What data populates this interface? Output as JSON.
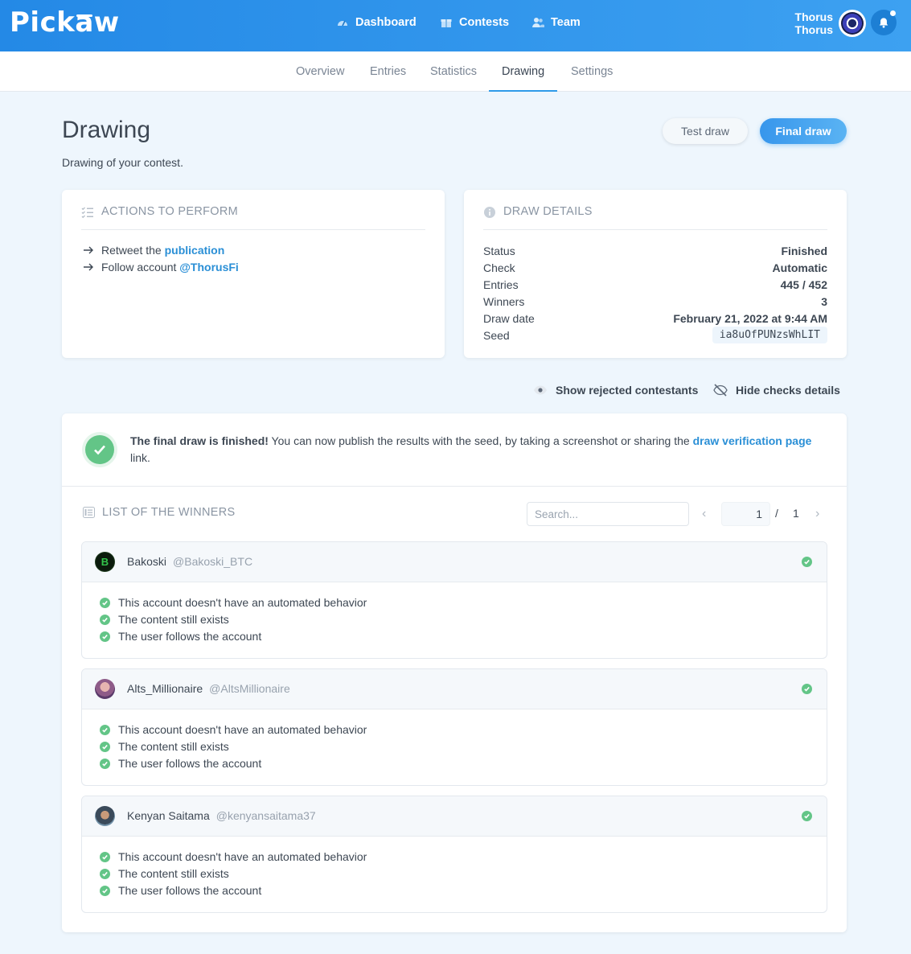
{
  "brand": {
    "logo_pre": "Pick",
    "logo_a": "a",
    "logo_post": "w"
  },
  "nav": {
    "dashboard": "Dashboard",
    "contests": "Contests",
    "team": "Team"
  },
  "user": {
    "line1": "Thorus",
    "line2": "Thorus"
  },
  "tabs": [
    "Overview",
    "Entries",
    "Statistics",
    "Drawing",
    "Settings"
  ],
  "active_tab": "Drawing",
  "page": {
    "title": "Drawing",
    "subtitle": "Drawing of your contest."
  },
  "buttons": {
    "test_draw": "Test draw",
    "final_draw": "Final draw"
  },
  "actions": {
    "heading": "ACTIONS TO PERFORM",
    "items": [
      {
        "text": "Retweet the ",
        "link": "publication"
      },
      {
        "text": "Follow account ",
        "link": "@ThorusFi"
      }
    ]
  },
  "details": {
    "heading": "DRAW DETAILS",
    "rows": [
      {
        "label": "Status",
        "value": "Finished"
      },
      {
        "label": "Check",
        "value": "Automatic"
      },
      {
        "label": "Entries",
        "value": "445 / 452"
      },
      {
        "label": "Winners",
        "value": "3"
      },
      {
        "label": "Draw date",
        "value": "February 21, 2022 at 9:44 AM"
      },
      {
        "label": "Seed",
        "value": "ia8uOfPUNzsWhLIT"
      }
    ]
  },
  "toggles": {
    "show_rejected": "Show rejected contestants",
    "hide_checks": "Hide checks details"
  },
  "result": {
    "bold": "The final draw is finished!",
    "text": " You can now publish the results with the seed, by taking a screenshot or sharing the ",
    "link": "draw verification page",
    "tail": " link."
  },
  "winners": {
    "heading": "LIST OF THE WINNERS",
    "search_placeholder": "Search...",
    "page_current": "1",
    "page_sep": "/",
    "page_total": "1",
    "items": [
      {
        "name": "Bakoski",
        "handle": "@Bakoski_BTC",
        "checks": [
          "This account doesn't have an automated behavior",
          "The content still exists",
          "The user follows the account"
        ]
      },
      {
        "name": "Alts_Millionaire",
        "handle": "@AltsMillionaire",
        "checks": [
          "This account doesn't have an automated behavior",
          "The content still exists",
          "The user follows the account"
        ]
      },
      {
        "name": "Kenyan Saitama",
        "handle": "@kenyansaitama37",
        "checks": [
          "This account doesn't have an automated behavior",
          "The content still exists",
          "The user follows the account"
        ]
      }
    ]
  },
  "colors": {
    "primary": "#2f9be9",
    "success": "#63c587",
    "link": "#2a8fd6"
  }
}
